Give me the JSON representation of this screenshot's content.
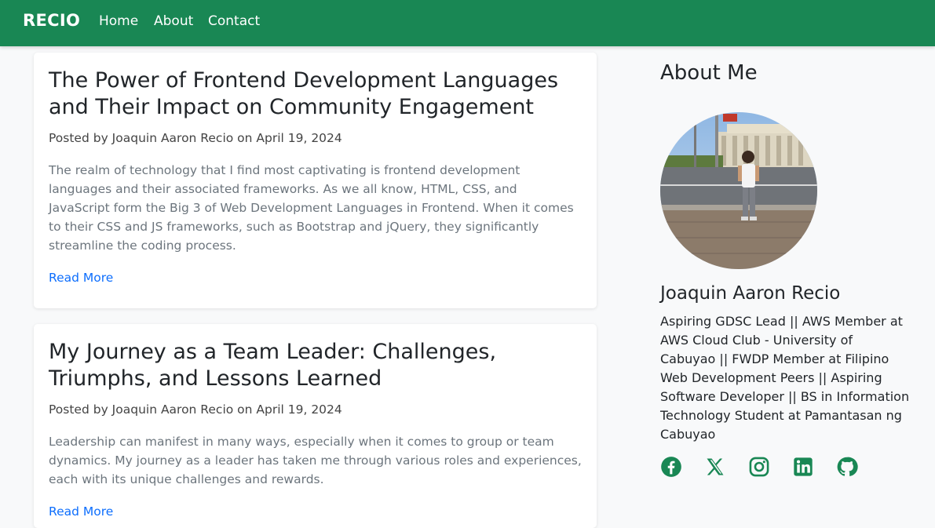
{
  "navbar": {
    "brand": "RECIO",
    "links": [
      "Home",
      "About",
      "Contact"
    ]
  },
  "posts": [
    {
      "title": "The Power of Frontend Development Languages and Their Impact on Community Engagement",
      "meta": "Posted by Joaquin Aaron Recio on April 19, 2024",
      "excerpt": "The realm of technology that I find most captivating is frontend development languages and their associated frameworks. As we all know, HTML, CSS, and JavaScript form the Big 3 of Web Development Languages in Frontend. When it comes to their CSS and JS frameworks, such as Bootstrap and jQuery, they significantly streamline the coding process.",
      "read_more": "Read More"
    },
    {
      "title": "My Journey as a Team Leader: Challenges, Triumphs, and Lessons Learned",
      "meta": "Posted by Joaquin Aaron Recio on April 19, 2024",
      "excerpt": "Leadership can manifest in many ways, especially when it comes to group or team dynamics. My journey as a leader has taken me through various roles and experiences, each with its unique challenges and rewards.",
      "read_more": "Read More"
    }
  ],
  "sidebar": {
    "heading": "About Me",
    "name": "Joaquin Aaron Recio",
    "bio": "Aspiring GDSC Lead || AWS Member at AWS Cloud Club - University of Cabuyao || FWDP Member at Filipino Web Development Peers || Aspiring Software Developer || BS in Information Technology Student at Pamantasan ng Cabuyao",
    "socials": [
      "facebook-icon",
      "x-twitter-icon",
      "instagram-icon",
      "linkedin-icon",
      "github-icon"
    ]
  },
  "colors": {
    "nav": "#198754",
    "link": "#0d6efd",
    "social": "#198754",
    "background": "#f8f9fa"
  }
}
